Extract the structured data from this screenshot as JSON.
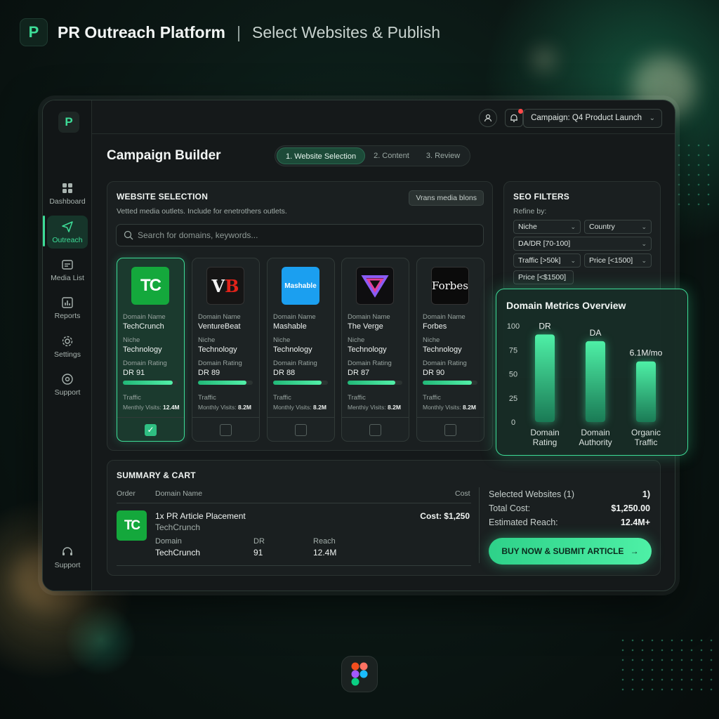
{
  "header": {
    "logo_letter": "P",
    "title": "PR Outreach Platform",
    "separator": "|",
    "subtitle": "Select Websites & Publish"
  },
  "sidebar": {
    "logo_letter": "P",
    "items": [
      {
        "label": "Dashboard",
        "icon": "grid-icon"
      },
      {
        "label": "Outreach",
        "icon": "send-icon",
        "active": true
      },
      {
        "label": "Media List",
        "icon": "media-icon"
      },
      {
        "label": "Reports",
        "icon": "chart-icon"
      },
      {
        "label": "Settings",
        "icon": "gear-icon"
      },
      {
        "label": "Support",
        "icon": "help-icon"
      }
    ],
    "bottom_item": {
      "label": "Support",
      "icon": "headset-icon"
    }
  },
  "topbar": {
    "campaign_label": "Campaign: Q4 Product Launch"
  },
  "page": {
    "title": "Campaign Builder",
    "steps": [
      "1. Website Selection",
      "2. Content",
      "3. Review"
    ]
  },
  "website_selection": {
    "title": "WEBSITE SELECTION",
    "subtitle": "Vetted media outlets. Include for enetrothers outlets.",
    "action": "Vrans media blons",
    "search_placeholder": "Search for domains, keywords...",
    "labels": {
      "domain": "Domain Name",
      "niche": "Niche",
      "rating": "Domain Rating",
      "traffic": "Traffic",
      "visits": "Monthly Visits:"
    },
    "cards": [
      {
        "logo": "TC",
        "domain": "TechCrunch",
        "niche": "Technology",
        "dr": "DR 91",
        "dr_value": 91,
        "visits": "12.4M",
        "selected": true
      },
      {
        "logo": "VB",
        "domain": "VentureBeat",
        "niche": "Technology",
        "dr": "DR 89",
        "dr_value": 89,
        "visits": "8.2M",
        "selected": false
      },
      {
        "logo": "Mashable",
        "domain": "Mashable",
        "niche": "Technology",
        "dr": "DR 88",
        "dr_value": 88,
        "visits": "8.2M",
        "selected": false
      },
      {
        "logo": "V",
        "domain": "The Verge",
        "niche": "Technology",
        "dr": "DR 87",
        "dr_value": 87,
        "visits": "8.2M",
        "selected": false
      },
      {
        "logo": "Forbes",
        "domain": "Forbes",
        "niche": "Technology",
        "dr": "DR 90",
        "dr_value": 90,
        "visits": "8.2M",
        "selected": false
      }
    ],
    "card_visit_labels": [
      "Menthly Visits:",
      "Monthly Visits:",
      "Monthly Visits:",
      "Menthiy Visits:",
      "Monthly Visits:"
    ]
  },
  "seo_filters": {
    "title": "SEO FILTERS",
    "refine": "Refine by:",
    "filters": [
      "Niche",
      "Country",
      "DA/DR [70-100]",
      "Traffic [>50k]",
      "Price [<1500]",
      "Price [<$1500]"
    ]
  },
  "metrics_overview": {
    "title": "Domain Metrics Overview",
    "accent": "#3ddc97"
  },
  "chart_data": {
    "type": "bar",
    "title": "Domain Metrics Overview",
    "categories": [
      "Domain Rating",
      "Domain Authority",
      "Organic Traffic"
    ],
    "values": [
      91,
      84,
      63
    ],
    "data_labels": [
      "DR",
      "DA",
      "6.1M/mo"
    ],
    "yticks": [
      0,
      25,
      50,
      75,
      100
    ],
    "ylim": [
      0,
      100
    ],
    "grid": false
  },
  "summary": {
    "title": "SUMMARY & CART",
    "headers": {
      "order": "Order",
      "domain": "Domain Name",
      "cost": "Cost"
    },
    "item": {
      "logo": "TC",
      "name": "1x PR Article Placement",
      "site": "TechCrunch",
      "cost": "Cost: $1,250",
      "detail_labels": [
        "Domain",
        "DR",
        "Reach"
      ],
      "detail_values": [
        "TechCrunch",
        "91",
        "12.4M"
      ]
    },
    "totals": [
      {
        "label": "Selected Websites (1)",
        "value": "1)"
      },
      {
        "label": "Total Cost:",
        "value": "$1,250.00"
      },
      {
        "label": "Estimated Reach:",
        "value": "12.4M+"
      }
    ],
    "buy_button": "BUY NOW & SUBMIT ARTICLE"
  }
}
